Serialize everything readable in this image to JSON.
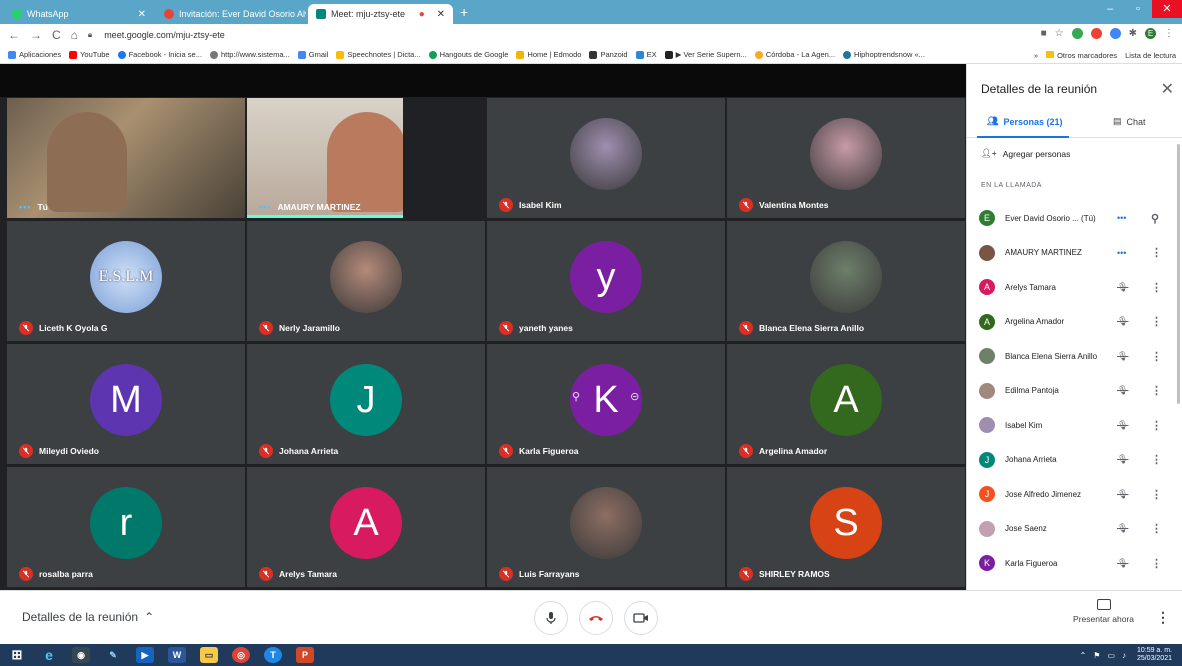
{
  "browser": {
    "tabs": [
      {
        "title": "WhatsApp",
        "color": "#25d366"
      },
      {
        "title": "Invitación: Ever David Osorio Alv",
        "color": "#ea4335"
      },
      {
        "title": "Meet: mju-ztsy-ete",
        "color": "#00897b"
      }
    ],
    "url": "meet.google.com/mju-ztsy-ete",
    "bookmarks": [
      "Aplicaciones",
      "YouTube",
      "Facebook - Inicia se...",
      "http://www.sistema...",
      "Gmail",
      "Speechnotes | Dicta...",
      "Hangouts de Google",
      "Home | Edmodo",
      "Panzoid",
      "EX",
      "▶ Ver Serie Supern...",
      "Córdoba - La Agen...",
      "Hiphoptrendsnow «..."
    ],
    "bookmarks_right": [
      "»",
      "Otros marcadores",
      "Lista de lectura"
    ],
    "profile_letter": "E"
  },
  "tiles": [
    {
      "name": "Tú",
      "type": "video",
      "speaking": true
    },
    {
      "name": "AMAURY MARTINEZ",
      "type": "video",
      "speaking": true
    },
    {
      "name": "Isabel Kim",
      "type": "photo",
      "color": "#9e8fb0"
    },
    {
      "name": "Valentina Montes",
      "type": "photo",
      "color": "#c89aa8"
    },
    {
      "name": "Liceth K Oyola G",
      "type": "photo",
      "color": "#7b9fd6",
      "logo_text": "E.S.L.M"
    },
    {
      "name": "Nerly Jaramillo",
      "type": "photo",
      "color": "#b58a7a"
    },
    {
      "name": "yaneth yanes",
      "type": "letter",
      "letter": "y",
      "color": "#7b1fa2"
    },
    {
      "name": "Blanca Elena Sierra Anillo",
      "type": "photo",
      "color": "#6e7f6a"
    },
    {
      "name": "Mileydi Oviedo",
      "type": "letter",
      "letter": "M",
      "color": "#5e35b1"
    },
    {
      "name": "Johana Arrieta",
      "type": "letter",
      "letter": "J",
      "color": "#00897b"
    },
    {
      "name": "Karla Figueroa",
      "type": "letter",
      "letter": "K",
      "color": "#7b1fa2",
      "hover": true
    },
    {
      "name": "Argelina Amador",
      "type": "letter",
      "letter": "A",
      "color": "#33691e"
    },
    {
      "name": "rosalba parra",
      "type": "letter",
      "letter": "r",
      "color": "#00796b"
    },
    {
      "name": "Arelys Tamara",
      "type": "letter",
      "letter": "A",
      "color": "#d81b60"
    },
    {
      "name": "Luis Farrayans",
      "type": "photo",
      "color": "#8d6e63"
    },
    {
      "name": "SHIRLEY RAMOS",
      "type": "letter",
      "letter": "S",
      "color": "#d84315"
    }
  ],
  "panel": {
    "title": "Detalles de la reunión",
    "people_tab": "Personas (21)",
    "chat_tab": "Chat",
    "add_people": "Agregar personas",
    "section": "EN LA LLAMADA",
    "participants": [
      {
        "name": "Ever David Osorio ... (Tú)",
        "letter": "E",
        "color": "#2e7d32",
        "status": "speaking"
      },
      {
        "name": "AMAURY MARTINEZ",
        "letter": "",
        "color": "#795548",
        "status": "speaking"
      },
      {
        "name": "Arelys Tamara",
        "letter": "A",
        "color": "#d81b60",
        "status": "muted"
      },
      {
        "name": "Argelina Amador",
        "letter": "A",
        "color": "#33691e",
        "status": "muted"
      },
      {
        "name": "Blanca Elena Sierra Anillo",
        "letter": "",
        "color": "#6e7f6a",
        "status": "muted"
      },
      {
        "name": "Edilma Pantoja",
        "letter": "",
        "color": "#a1887f",
        "status": "muted"
      },
      {
        "name": "Isabel Kim",
        "letter": "",
        "color": "#9e8fb0",
        "status": "muted"
      },
      {
        "name": "Johana Arrieta",
        "letter": "J",
        "color": "#00897b",
        "status": "muted"
      },
      {
        "name": "Jose Alfredo Jimenez",
        "letter": "J",
        "color": "#f4511e",
        "status": "muted"
      },
      {
        "name": "Jose Saenz",
        "letter": "",
        "color": "#c2a0b0",
        "status": "muted"
      },
      {
        "name": "Karla Figueroa",
        "letter": "K",
        "color": "#7b1fa2",
        "status": "muted"
      }
    ]
  },
  "bottom": {
    "meeting_details": "Detalles de la reunión",
    "present": "Presentar ahora"
  },
  "taskbar": {
    "time": "10:59 a. m.",
    "date": "25/03/2021"
  }
}
